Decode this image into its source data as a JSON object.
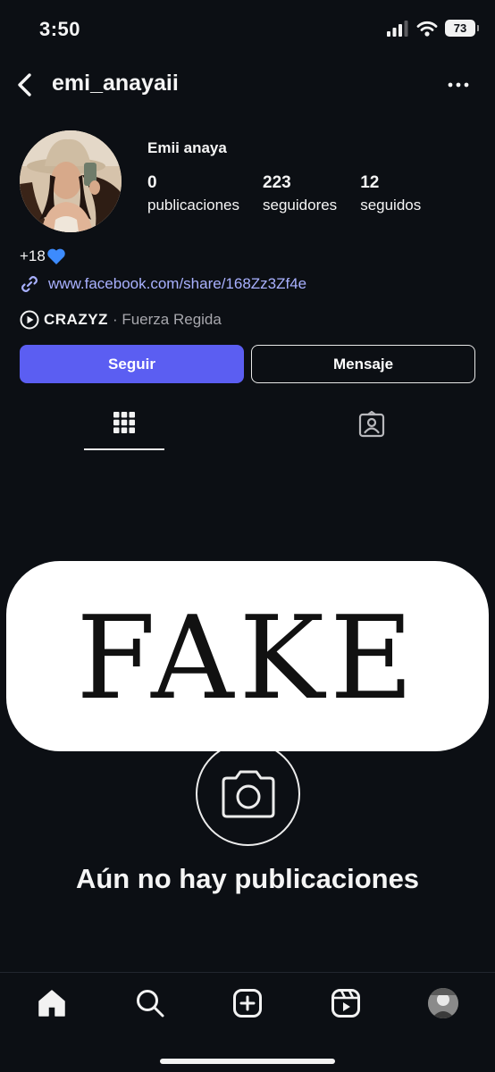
{
  "status_bar": {
    "time": "3:50",
    "battery": "73"
  },
  "header": {
    "username": "emi_anayaii"
  },
  "profile": {
    "display_name": "Emii anaya",
    "stats": [
      {
        "value": "0",
        "label": "publicaciones"
      },
      {
        "value": "223",
        "label": "seguidores"
      },
      {
        "value": "12",
        "label": "seguidos"
      }
    ],
    "bio": "+18",
    "bio_emoji": "blue-heart-icon",
    "link": "www.facebook.com/share/168Zz3Zf4e",
    "music": {
      "artist": "CRAZYZ",
      "song": "· Fuerza Regida"
    }
  },
  "actions": {
    "follow_label": "Seguir",
    "message_label": "Mensaje"
  },
  "tabs": [
    "grid-icon",
    "tagged-icon"
  ],
  "overlay": {
    "text": "FAKE"
  },
  "empty_state": {
    "title": "Aún no hay publicaciones"
  },
  "bottom_nav": [
    "home-icon",
    "search-icon",
    "create-icon",
    "reels-icon",
    "profile-avatar"
  ],
  "colors": {
    "background": "#0c0f14",
    "follow_button": "#5b5ef2",
    "link": "#a9b1ff",
    "heart": "#3d8bfd"
  }
}
